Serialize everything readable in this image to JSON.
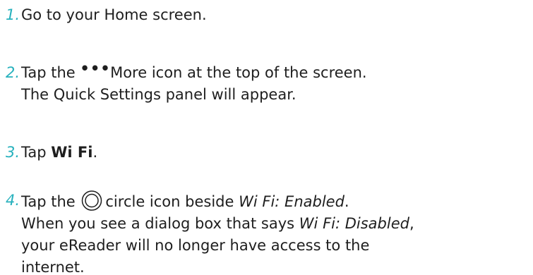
{
  "steps": [
    {
      "number": "1.",
      "text": "Go to your Home screen."
    },
    {
      "number": "2.",
      "pre": "Tap the",
      "icon": "more-icon",
      "icon_glyph": "•••",
      "post": "More icon at the top of the screen.",
      "line2": "The Quick Settings panel will appear."
    },
    {
      "number": "3.",
      "pre": "Tap",
      "bold": "Wi Fi",
      "post": "."
    },
    {
      "number": "4.",
      "pre": "Tap the",
      "icon": "circle-icon",
      "post": "circle icon beside",
      "italic": "Wi Fi: Enabled",
      "post2": ".",
      "line2_pre": "When you see a dialog box that says",
      "line2_italic": "Wi Fi: Disabled",
      "line2_post": ",",
      "line3": "your eReader will no longer have access to the",
      "line4": "internet."
    }
  ],
  "colors": {
    "step_number": "#27b1bd",
    "text": "#1e1e1e"
  }
}
